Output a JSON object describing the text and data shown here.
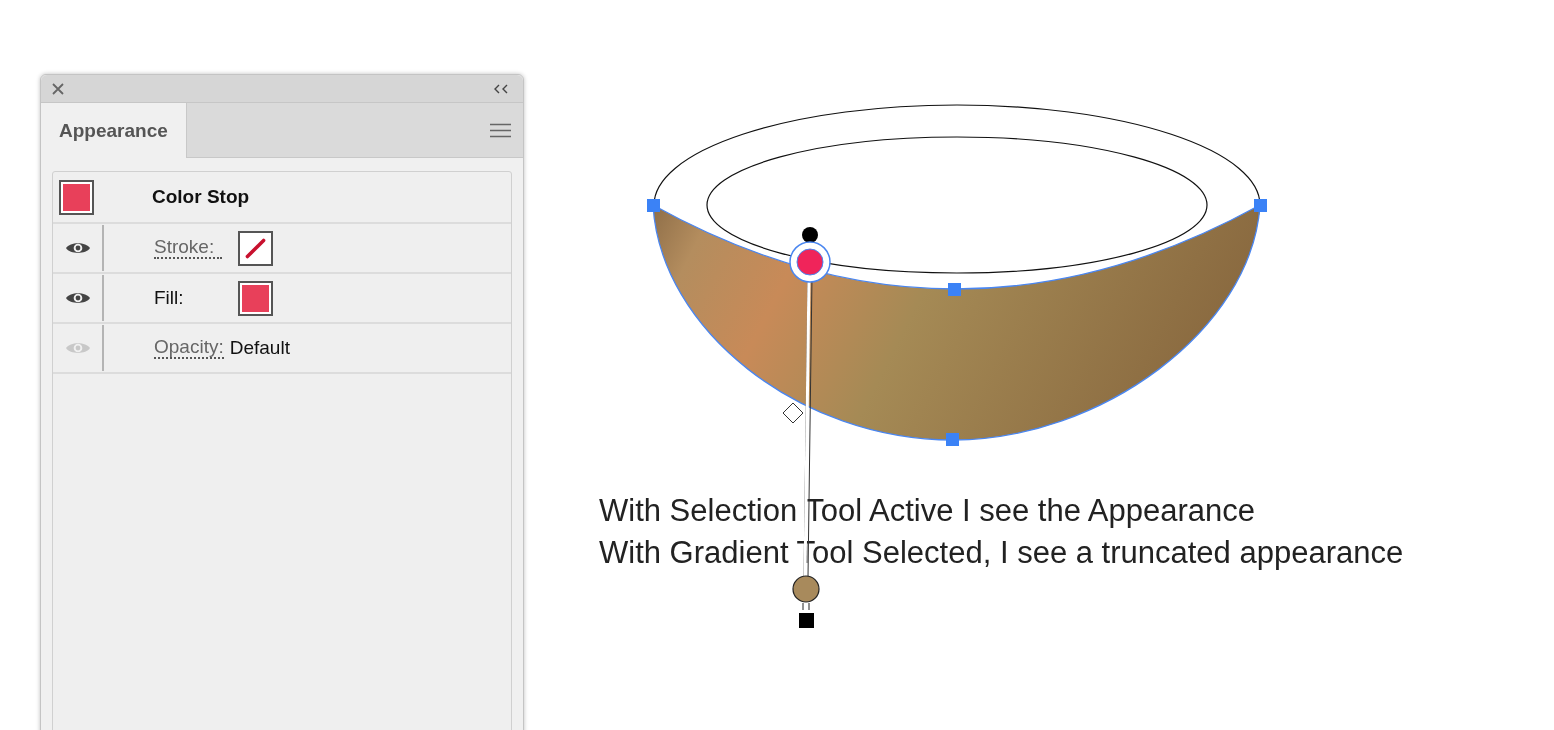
{
  "panel": {
    "tabs": [
      {
        "label": "Appearance",
        "selected": true
      }
    ],
    "header": {
      "label": "Color Stop",
      "color": "#e8405a"
    },
    "rows": [
      {
        "kind": "stroke",
        "label": "Stroke:",
        "eye_enabled": true
      },
      {
        "kind": "fill",
        "label": "Fill:",
        "eye_enabled": true,
        "color": "#e8405a"
      },
      {
        "kind": "opacity",
        "label": "Opacity:",
        "value": "Default",
        "eye_enabled": false
      }
    ]
  },
  "canvas": {
    "notes": [
      "With Selection Tool Active I see the Appearance",
      "With Gradient Tool Selected, I see a truncated appearance"
    ]
  }
}
